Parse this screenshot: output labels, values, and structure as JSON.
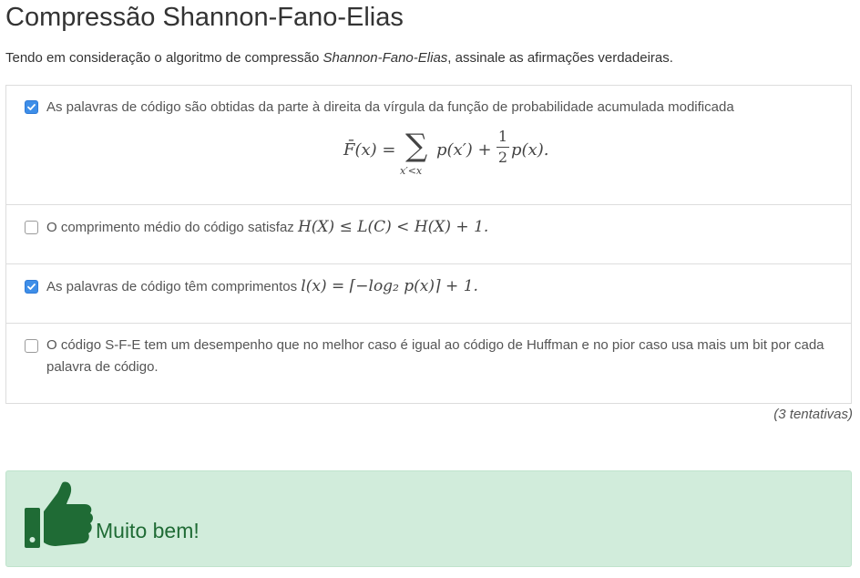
{
  "title": "Compressão Shannon-Fano-Elias",
  "prompt": {
    "before": "Tendo em consideração o algoritmo de compressão ",
    "emphasis": "Shannon-Fano-Elias",
    "after": ", assinale as afirmações verdadeiras."
  },
  "options": [
    {
      "checked": true,
      "text": "As palavras de código são obtidas da parte à direita da vírgula da função de probabilidade acumulada modificada",
      "formula": {
        "lhs": "F̄(x) =",
        "sigma": "∑",
        "under": "x′<x",
        "rhs1": "p(x′) +",
        "num": "1",
        "den": "2",
        "rhs2": "p(x)."
      }
    },
    {
      "checked": false,
      "text": "O comprimento médio do código satisfaz ",
      "math": "H(X) ≤ L(C) < H(X) + 1."
    },
    {
      "checked": true,
      "text": "As palavras de código têm comprimentos ",
      "math": "l(x) = ⌈−log₂ p(x)⌉ + 1."
    },
    {
      "checked": false,
      "text": "O código S-F-E tem um desempenho que no melhor caso é igual ao código de Huffman e no pior caso usa mais um bit por cada palavra de código."
    }
  ],
  "attempts": "(3 tentativas)",
  "feedback": {
    "icon": "thumbs-up-icon",
    "message": "Muito bem!",
    "color": "#1f6b35",
    "background": "#d1ecdb"
  },
  "checkbox_color": "#3e8ee8"
}
